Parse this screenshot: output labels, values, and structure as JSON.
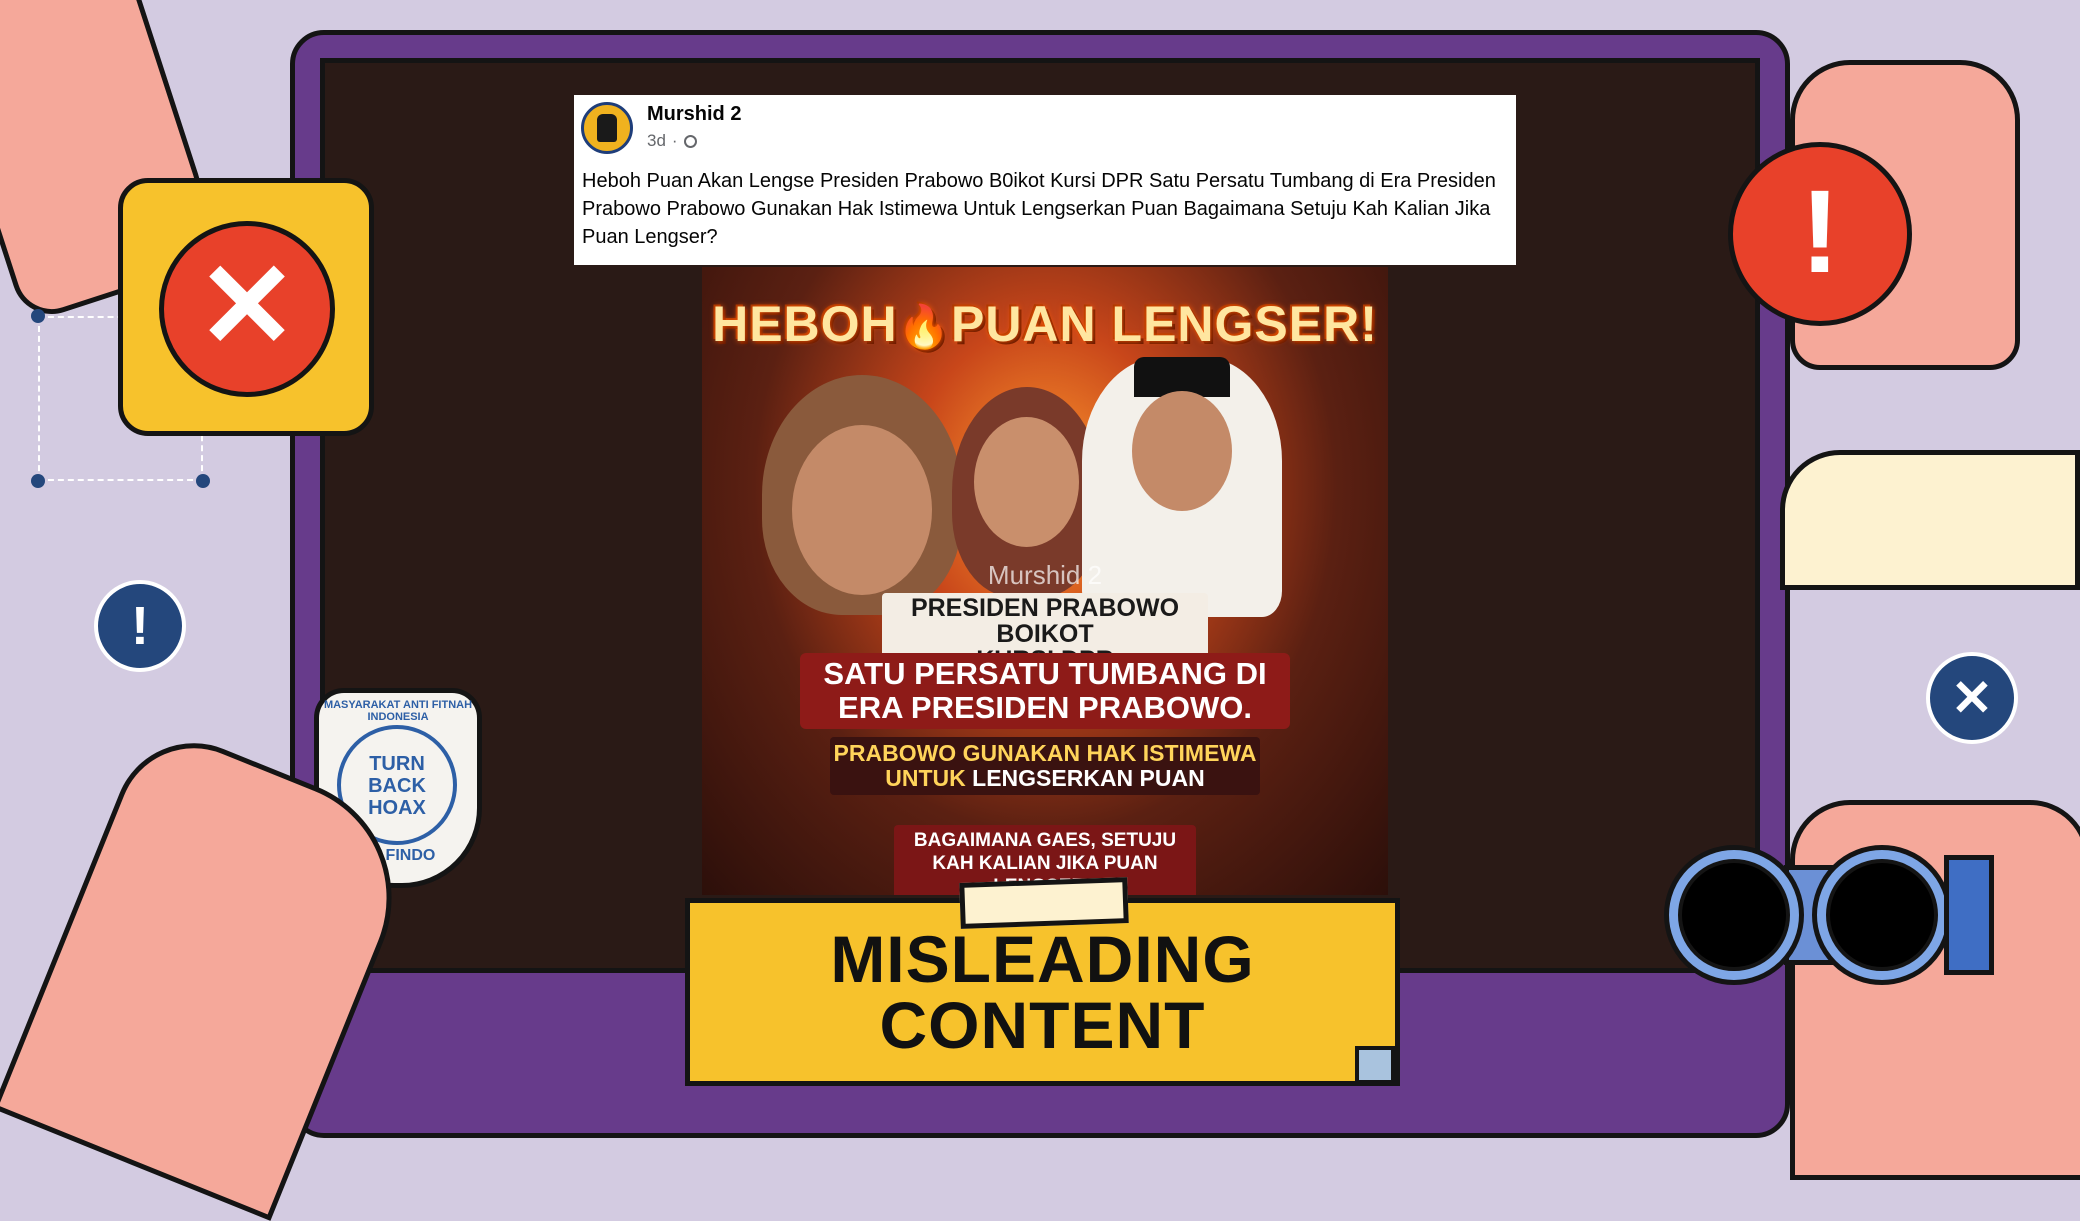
{
  "post": {
    "author": "Murshid 2",
    "time": "3d",
    "separator": "·",
    "text": "Heboh Puan Akan Lengse Presiden Prabowo B0ikot Kursi DPR Satu Persatu Tumbang di Era Presiden Prabowo Prabowo Gunakan Hak Istimewa Untuk Lengserkan Puan Bagaimana Setuju Kah Kalian Jika Puan Lengser?"
  },
  "graphic": {
    "title_left": "HEBOH",
    "title_right": "PUAN LENGSER!",
    "watermark": "Murshid 2",
    "caption1_line1": "PRESIDEN PRABOWO BOIKOT",
    "caption1_line2": "KURSI DPR",
    "caption2_line1": "SATU PERSATU TUMBANG DI",
    "caption2_line2": "ERA PRESIDEN PRABOWO.",
    "caption3_line1": "PRABOWO GUNAKAN HAK ISTIMEWA",
    "caption3_line2a": "UNTUK",
    "caption3_line2b": " LENGSERKAN PUAN",
    "caption4_line1": "BAGAIMANA GAES, SETUJU",
    "caption4_line2": "KAH KALIAN JIKA PUAN LENGSER?"
  },
  "verdict": {
    "line1": "MISLEADING",
    "line2": "CONTENT"
  },
  "badge": {
    "arc_text": "MASYARAKAT ANTI FITNAH INDONESIA",
    "center_line1": "TURN",
    "center_line2": "BACK",
    "center_line3": "HOAX",
    "bottom": "MAFINDO"
  },
  "icons": {
    "x_symbol": "✕",
    "exclaim_symbol": "!",
    "globe_symbol": "🌐"
  },
  "colors": {
    "background": "#d3cbe1",
    "frame": "#673b8b",
    "accent_yellow": "#f7c22c",
    "accent_red": "#e8412a",
    "accent_blue": "#24477c"
  }
}
